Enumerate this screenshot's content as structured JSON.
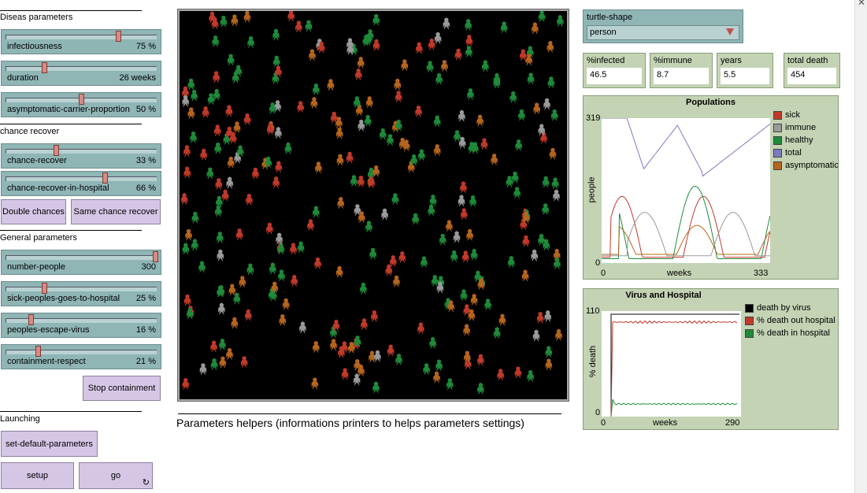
{
  "sections": {
    "disease": "Diseas parameters",
    "chance": "chance recover",
    "general": "General parameters",
    "launching": "Launching"
  },
  "sliders": [
    {
      "name": "infectiousness",
      "value": "75 %",
      "fraction": 0.75
    },
    {
      "name": "duration",
      "value": "26 weeks",
      "fraction": 0.25
    },
    {
      "name": "asymptomatic-carrier-proportion",
      "value": "50 %",
      "fraction": 0.5
    },
    {
      "name": "chance-recover",
      "value": "33 %",
      "fraction": 0.33
    },
    {
      "name": "chance-recover-in-hospital",
      "value": "66 %",
      "fraction": 0.66
    },
    {
      "name": "number-people",
      "value": "300",
      "fraction": 1.0
    },
    {
      "name": "sick-peoples-goes-to-hospital",
      "value": "25 %",
      "fraction": 0.25
    },
    {
      "name": "peoples-escape-virus",
      "value": "16 %",
      "fraction": 0.16
    },
    {
      "name": "containment-respect",
      "value": "21 %",
      "fraction": 0.21
    }
  ],
  "buttons": {
    "double_chances": "Double chances",
    "same_chance": "Same chance recover",
    "stop_containment": "Stop containment",
    "set_default": "set-default-parameters",
    "setup": "setup",
    "go": "go",
    "go_icon": "forever-icon"
  },
  "helpers_text": "Parameters helpers (informations printers to helps parameters settings)",
  "chooser": {
    "label": "turtle-shape",
    "value": "person"
  },
  "monitors": [
    {
      "label": "%infected",
      "value": "46.5"
    },
    {
      "label": "%immune",
      "value": "8.7"
    },
    {
      "label": "years",
      "value": "5.5"
    },
    {
      "label": "total death",
      "value": "454"
    }
  ],
  "colors": {
    "sick": "#c0392b",
    "immune": "#9a9a9a",
    "healthy": "#1e8a3a",
    "total": "#7b7bbf",
    "asymptomatic": "#b5651d",
    "death_by_virus": "#000000"
  },
  "populations_plot": {
    "title": "Populations",
    "ylabel": "people",
    "xlabel": "weeks",
    "ymax": "319",
    "ymin": "0",
    "xmin": "0",
    "xmax": "333",
    "legend": [
      {
        "name": "sick",
        "color": "#c0392b"
      },
      {
        "name": "immune",
        "color": "#9a9a9a"
      },
      {
        "name": "healthy",
        "color": "#1e8a3a"
      },
      {
        "name": "total",
        "color": "#7b7bbf"
      },
      {
        "name": "asymptomatic",
        "color": "#b5651d"
      }
    ]
  },
  "virus_plot": {
    "title": "Virus and Hospital",
    "ylabel": "% death",
    "xlabel": "weeks",
    "ymax": "110",
    "ymin": "0",
    "xmin": "0",
    "xmax": "290",
    "legend": [
      {
        "name": "death by virus",
        "color": "#000000"
      },
      {
        "name": "% death out hospital",
        "color": "#c0392b"
      },
      {
        "name": "% death in hospital",
        "color": "#1e8a3a"
      }
    ]
  }
}
